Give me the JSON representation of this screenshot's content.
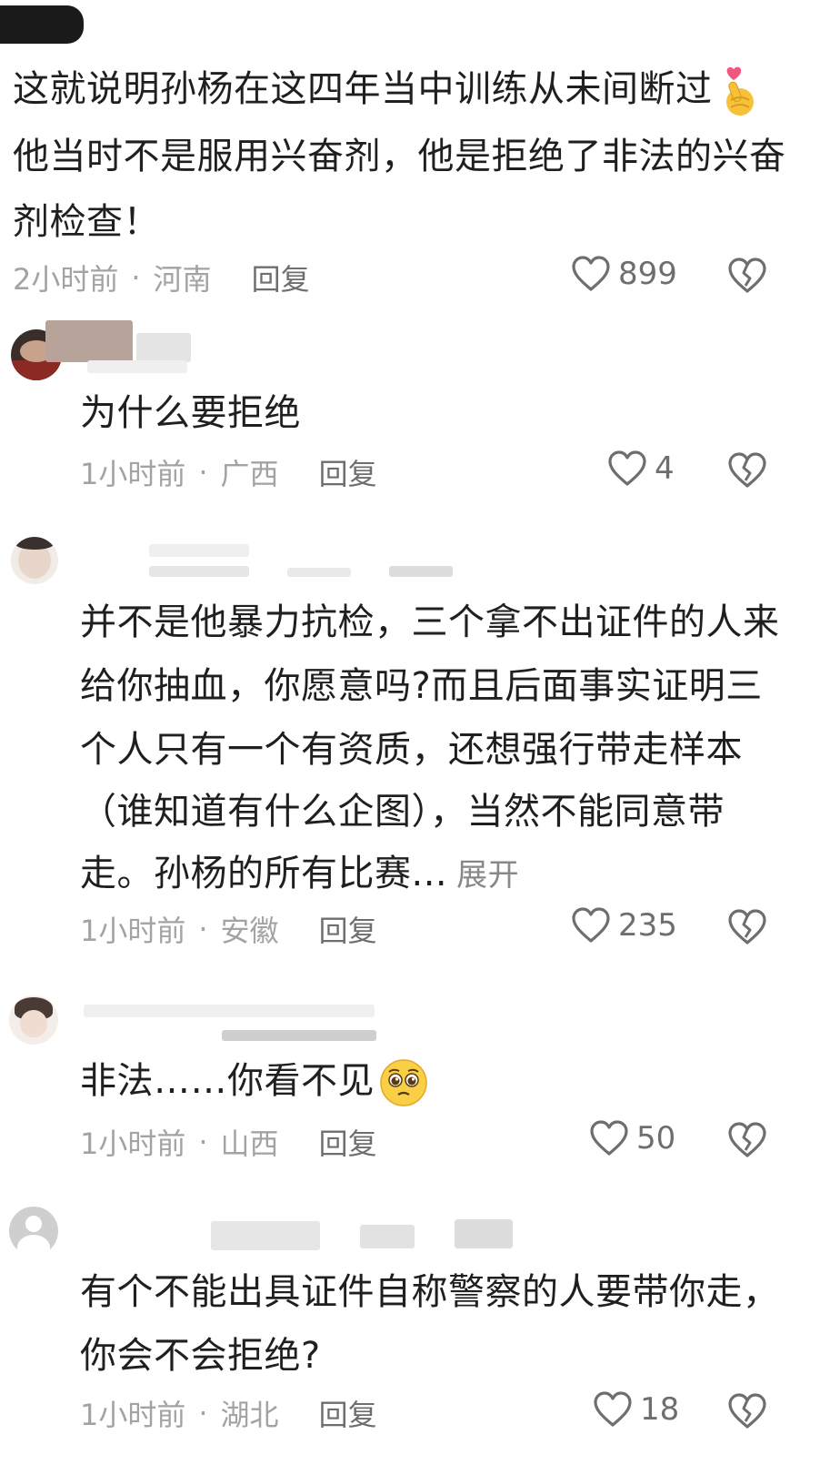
{
  "comments": [
    {
      "lines": [
        "这就说明孙杨在这四年当中训练从未间断过",
        "他当时不是服用兴奋剂，他是拒绝了非法的兴奋",
        "剂检查！"
      ],
      "time": "2小时前",
      "dot": "·",
      "location": "河南",
      "reply": "回复",
      "likes": "899"
    },
    {
      "lines": [
        "为什么要拒绝"
      ],
      "time": "1小时前",
      "dot": "·",
      "location": "广西",
      "reply": "回复",
      "likes": "4"
    },
    {
      "lines": [
        "并不是他暴力抗检，三个拿不出证件的人来",
        "给你抽血，你愿意吗?而且后面事实证明三",
        "个人只有一个有资质，还想强行带走样本",
        "（谁知道有什么企图），当然不能同意带",
        "走。孙杨的所有比赛..."
      ],
      "expand": "展开",
      "time": "1小时前",
      "dot": "·",
      "location": "安徽",
      "reply": "回复",
      "likes": "235"
    },
    {
      "lines": [
        "非法……你看不见"
      ],
      "time": "1小时前",
      "dot": "·",
      "location": "山西",
      "reply": "回复",
      "likes": "50"
    },
    {
      "lines": [
        "有个不能出具证件自称警察的人要带你走，",
        "你会不会拒绝?"
      ],
      "time": "1小时前",
      "dot": "·",
      "location": "湖北",
      "reply": "回复",
      "likes": "18"
    }
  ],
  "icons": {
    "like": "heart-outline-icon",
    "dislike": "broken-heart-icon",
    "emoji_finger_heart": "finger-heart-emoji",
    "emoji_pleading": "pleading-face-emoji"
  },
  "colors": {
    "text": "#1f1f1f",
    "meta": "#a3a3a3",
    "reply": "#6e6e6e",
    "background": "#ffffff"
  }
}
